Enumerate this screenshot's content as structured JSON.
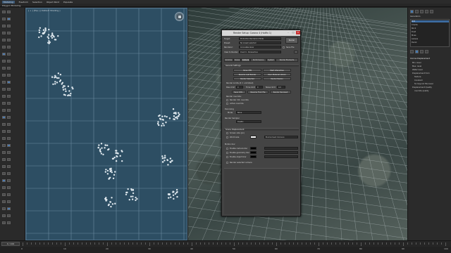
{
  "ribbon": {
    "tabs": [
      "Modeling",
      "Freeform",
      "Selection",
      "Object Paint",
      "Populate"
    ],
    "active_tab": 0,
    "subtitle": "Polygon Modeling"
  },
  "left_viewport": {
    "label": "[ + ] [Top ] [ Default Shading ]"
  },
  "command_panel": {
    "title": "Generators",
    "items": [
      "Dirt",
      "Cracks",
      "Rock",
      "Dust",
      "Moss",
      "Leaves",
      "Decal",
      "CoronaDisp Map"
    ],
    "selected_index": 0,
    "section": "Corona Displacement",
    "options": [
      "Min. level",
      "Max. level",
      "Water level",
      "Displacement from",
      "Texture",
      "Constant",
      "for beyond this level",
      "Displacement Quality",
      "override quality"
    ]
  },
  "dialog": {
    "title": "Render Setup: Corona 4 (Hotfix 1)",
    "fields": [
      {
        "label": "Target:",
        "value": "Production Rendering Mode"
      },
      {
        "label": "Preset:",
        "value": "No preset selected"
      },
      {
        "label": "Renderer:",
        "value": "CoronaRenderer"
      },
      {
        "label": "View to Render:",
        "value": "Quad 4 - Perspective"
      }
    ],
    "save_file_label": "Save File",
    "render_button": "Render",
    "tabs": [
      "Common",
      "Scene",
      "Camera",
      "Performance",
      "System",
      "Render Elements"
    ],
    "selected_tab": 2,
    "scene_section": "General Settings",
    "buttons_row1": [
      "Show VFB",
      "Start Interactive"
    ],
    "buttons_row2": [
      "Resume Last Render",
      "Open Material Library"
    ],
    "buttons_row3": [
      "Render Selected",
      "Render Region"
    ],
    "limits_label": "Render Limits (0 = unlimited)",
    "pass_limit_label": "Pass limit",
    "pass_limit": "0",
    "time_label": "Time limit",
    "time_value": "0",
    "noise_label": "Noise limit",
    "noise_value": "4.0",
    "lock_buttons": [
      "Save CXR...",
      "Resume From File",
      "Render Denoised"
    ],
    "overrides": [
      "Render override:",
      "Render mtl. override",
      "Active override"
    ],
    "denoise_label": "Denoising",
    "denoise_mode": "Mode",
    "denoise_value": "None",
    "sampler_label": "Render Sampler",
    "sampler_value": "Quality",
    "displacement_section": "Scene Displacement",
    "disp_options": [
      "Screen size (px)",
      "World size"
    ],
    "disp_value": "Environment (Corona)",
    "mblur_label": "Motion blur",
    "mblur_options": [
      "Enable camera blur",
      "Enable geometry blur",
      "Enable object blur"
    ],
    "footer": "Render selected camera"
  },
  "timeline": {
    "frame_label": "0 / 100",
    "ticks": [
      "0",
      "10",
      "20",
      "30",
      "40",
      "50",
      "60",
      "70",
      "80",
      "90",
      "100"
    ]
  },
  "colors": {
    "viewport_blue": "#2d4e63",
    "accent": "#3c6a9e",
    "close_red": "#c83232"
  }
}
